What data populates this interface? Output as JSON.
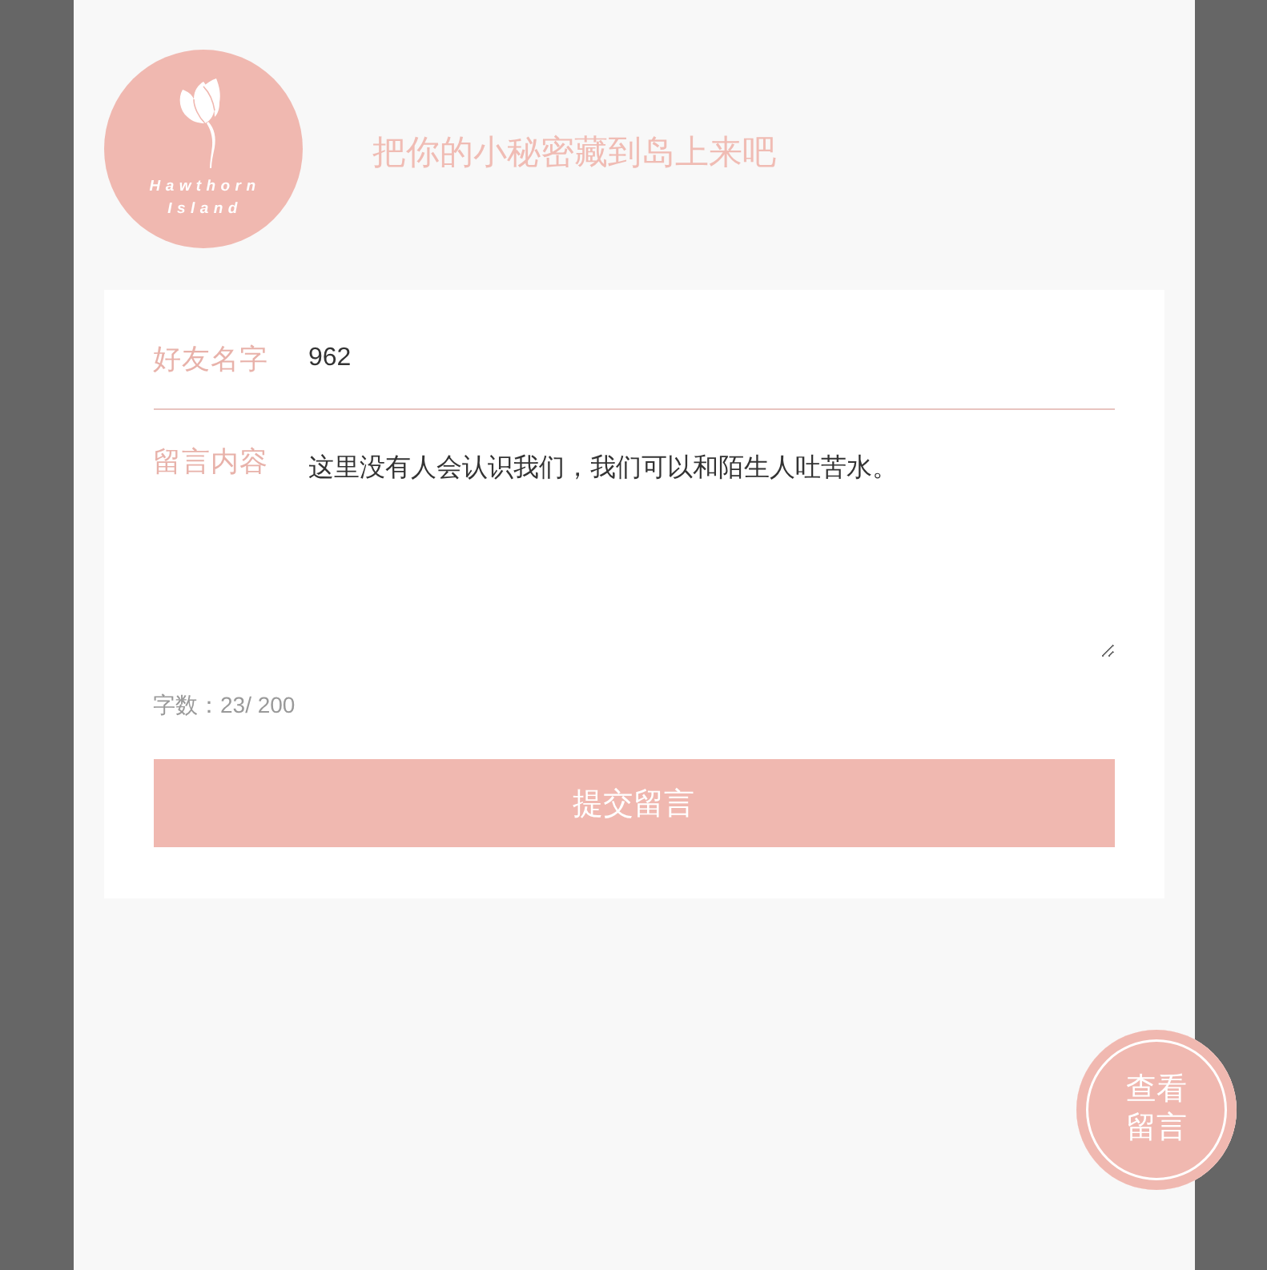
{
  "header": {
    "logo": {
      "lines": [
        "Hawthorn",
        "Island"
      ]
    },
    "title": "把你的小秘密藏到岛上来吧"
  },
  "form": {
    "fields": [
      {
        "kind": "input",
        "label": "好友名字",
        "value": "962"
      },
      {
        "kind": "textarea",
        "label": "留言内容",
        "value": "这里没有人会认识我们，我们可以和陌生人吐苦水。"
      }
    ],
    "counter": "字数：23/ 200",
    "submit_button": "提交留言"
  },
  "floating_button": {
    "label": "查看留言"
  }
}
